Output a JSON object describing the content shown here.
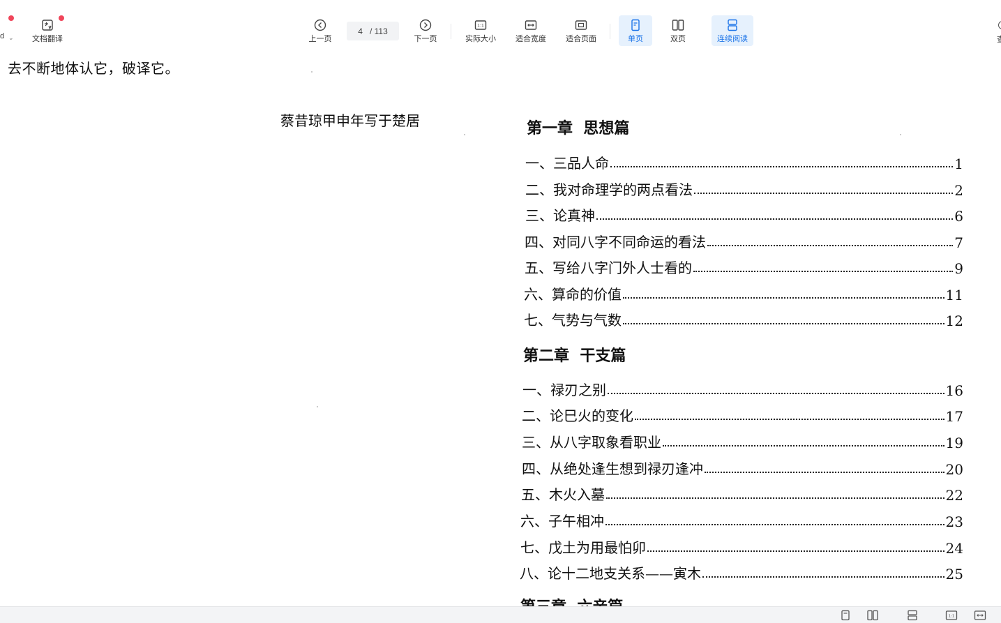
{
  "toolbar": {
    "left_cut": "d",
    "translate_label": "文档翻译",
    "prev_label": "上一页",
    "page_current": "4",
    "page_total": "/ 113",
    "next_label": "下一页",
    "actual_size_label": "实际大小",
    "fit_width_label": "适合宽度",
    "fit_page_label": "适合页面",
    "single_label": "单页",
    "double_label": "双页",
    "continuous_label": "连续阅读",
    "right_cut": "查",
    "accent_color": "#1a73e8"
  },
  "left_page": {
    "line": "去不断地体认它，破译它。",
    "signature": "蔡昔琼甲申年写于楚居"
  },
  "toc": {
    "chapters": [
      {
        "title": "第一章  思想篇",
        "items": [
          {
            "label": "一、三品人命",
            "page": "1"
          },
          {
            "label": "二、我对命理学的两点看法",
            "page": "2"
          },
          {
            "label": "三、论真神",
            "page": "6"
          },
          {
            "label": "四、对同八字不同命运的看法",
            "page": "7"
          },
          {
            "label": "五、写给八字门外人士看的",
            "page": "9"
          },
          {
            "label": "六、算命的价值",
            "page": "11"
          },
          {
            "label": "七、气势与气数",
            "page": "12"
          }
        ]
      },
      {
        "title": "第二章  干支篇",
        "items": [
          {
            "label": "一、禄刃之别",
            "page": "16"
          },
          {
            "label": "二、论巳火的变化",
            "page": "17"
          },
          {
            "label": "三、从八字取象看职业",
            "page": "19"
          },
          {
            "label": "四、从绝处逢生想到禄刃逢冲",
            "page": "20"
          },
          {
            "label": "五、木火入墓",
            "page": "22"
          },
          {
            "label": "六、子午相冲",
            "page": "23"
          },
          {
            "label": "七、戊土为用最怕卯",
            "page": "24"
          },
          {
            "label": "八、论十二地支关系——寅木",
            "page": "25"
          }
        ]
      },
      {
        "title": "第三章  六亲篇",
        "items": []
      }
    ]
  },
  "statusbar": {
    "icons": [
      "single-page-icon",
      "double-page-icon",
      "continuous-icon",
      "actual-size-icon",
      "fit-width-icon"
    ]
  }
}
